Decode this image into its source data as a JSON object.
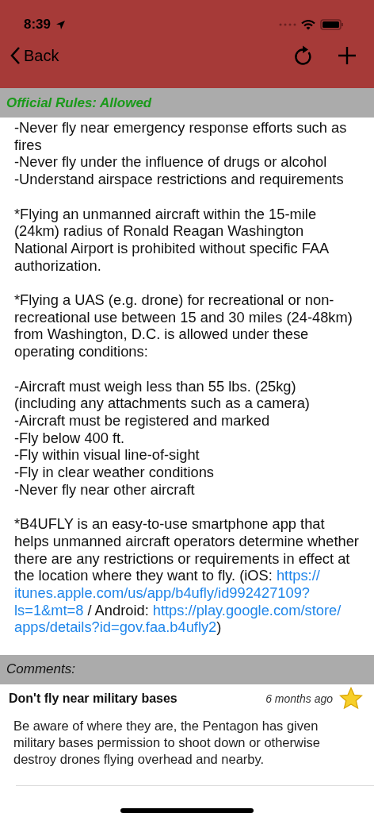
{
  "status_bar": {
    "time": "8:39"
  },
  "nav": {
    "back": "Back"
  },
  "rules_header": {
    "label": "Official Rules:",
    "status": "Allowed",
    "color": "#1a9a1a"
  },
  "sections": [
    {
      "items": [
        {
          "kind": "line",
          "text": "-Never fly near emergency response efforts such as fires"
        },
        {
          "kind": "line",
          "text": "-Never fly under the influence of drugs or alcohol"
        },
        {
          "kind": "line",
          "text": "-Understand airspace restrictions and requirements"
        }
      ]
    },
    {
      "items": [
        {
          "kind": "para",
          "text": "*Flying an unmanned aircraft within the 15-mile (24km) radius of Ronald Reagan Washington National Airport is prohibited without specific FAA authorization."
        }
      ]
    },
    {
      "items": [
        {
          "kind": "para",
          "text": "*Flying a UAS (e.g. drone) for recreational or non-recreational use between 15 and 30 miles (24-48km) from Washington, D.C. is allowed under these operating conditions:"
        }
      ]
    },
    {
      "items": [
        {
          "kind": "line",
          "text": "-Aircraft must weigh less than 55 lbs. (25kg) (including any attachments such as a camera)"
        },
        {
          "kind": "line",
          "text": "-Aircraft must be registered and marked"
        },
        {
          "kind": "line",
          "text": "-Fly below 400 ft."
        },
        {
          "kind": "line",
          "text": "-Fly within visual line-of-sight"
        },
        {
          "kind": "line",
          "text": "-Fly in clear weather conditions"
        },
        {
          "kind": "line",
          "text": "-Never fly near other aircraft"
        }
      ]
    },
    {
      "items": [
        {
          "kind": "lines",
          "lines": [
            [
              {
                "text": "*B4UFLY is an easy-to-use smartphone app that"
              }
            ],
            [
              {
                "text": "helps unmanned aircraft operators determine whether"
              }
            ],
            [
              {
                "text": "there are any restrictions or requirements in effect at"
              }
            ],
            [
              {
                "text": "the location where they want to fly. (iOS: "
              },
              {
                "text": "https://",
                "kind": "link"
              }
            ],
            [
              {
                "text": "itunes.apple.com/us/app/b4ufly/id992427109?",
                "kind": "link"
              }
            ],
            [
              {
                "text": "ls=1&mt=8",
                "kind": "link"
              },
              {
                "text": " / Android: "
              },
              {
                "text": "https://play.google.com/store/",
                "kind": "link"
              }
            ],
            [
              {
                "text": "apps/details?id=gov.faa.b4ufly2",
                "kind": "link"
              },
              {
                "text": ")"
              }
            ]
          ]
        }
      ]
    }
  ],
  "comments_header": "Comments:",
  "comments": [
    {
      "title": "Don't fly near military bases",
      "time": "6 months ago",
      "starred": true,
      "body": "Be aware of where they are, the Pentagon has given military bases permission to shoot down or otherwise destroy drones flying overhead and nearby."
    }
  ]
}
